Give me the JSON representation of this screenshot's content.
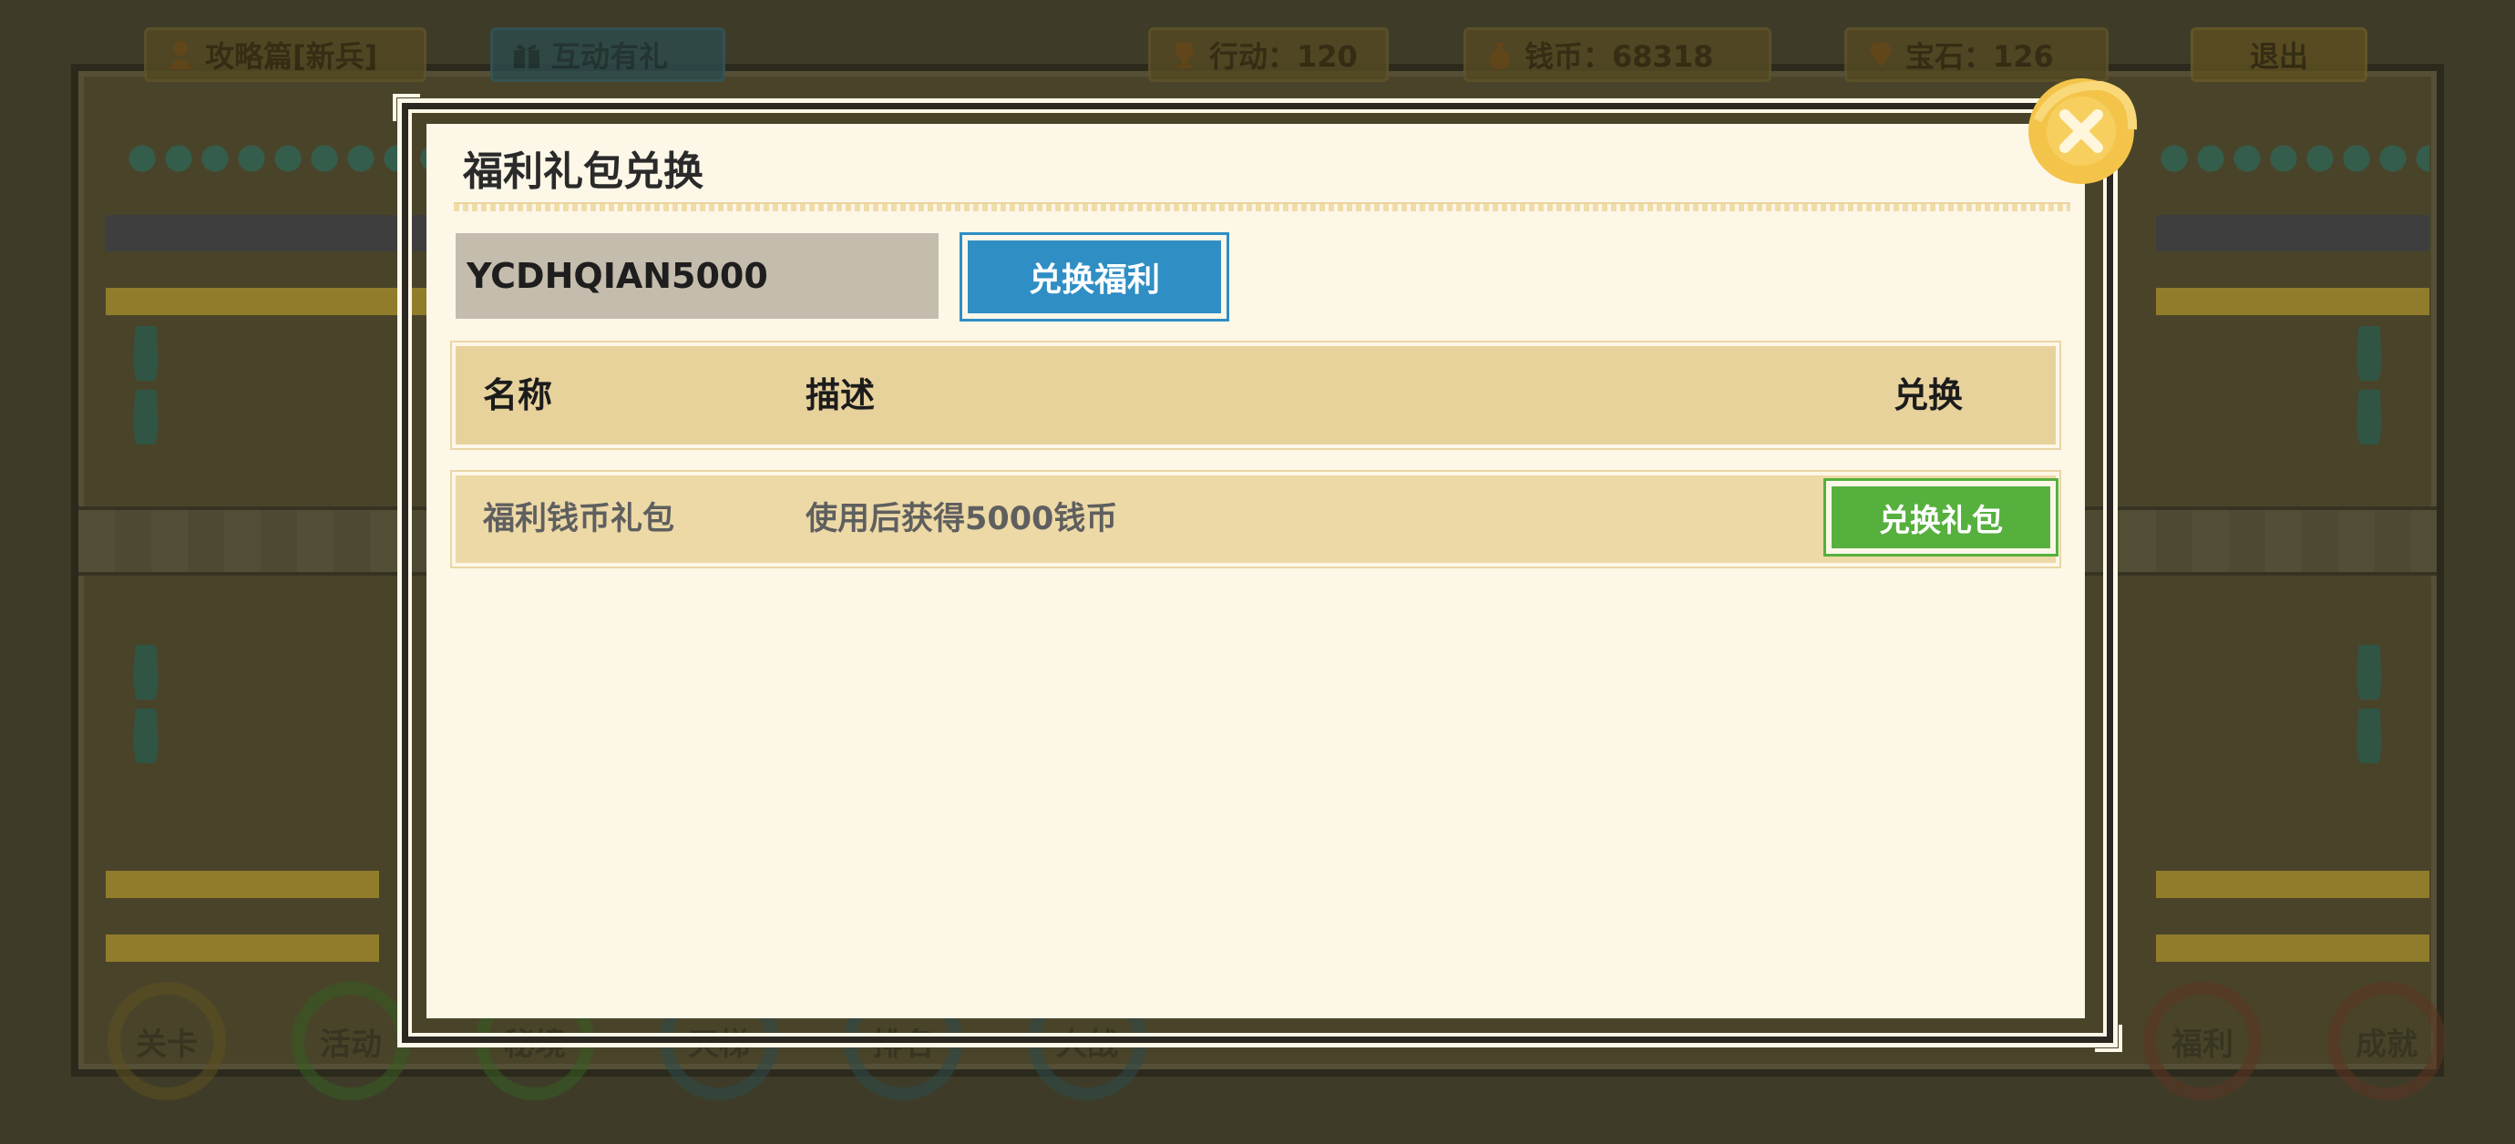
{
  "hud": {
    "guide_label": "攻略篇[新兵]",
    "gift_label": "互动有礼",
    "actions_label": "行动：120",
    "coins_label": "钱币：68318",
    "gems_label": "宝石：126",
    "exit_label": "退出"
  },
  "bottom_nav": [
    {
      "label": "关卡",
      "color": "#7a6428"
    },
    {
      "label": "活动",
      "color": "#3f7a2a"
    },
    {
      "label": "秘境",
      "color": "#3f7a2a"
    },
    {
      "label": "天梯",
      "color": "#2f5d6a"
    },
    {
      "label": "排名",
      "color": "#2f5d6a"
    },
    {
      "label": "大战",
      "color": "#2f5d6a"
    },
    {
      "label": "福利",
      "color": "#7a3a2a"
    },
    {
      "label": "成就",
      "color": "#7a3a2a"
    }
  ],
  "dialog": {
    "title": "福利礼包兑换",
    "code_value": "YCDHQIAN5000",
    "redeem_label": "兑换福利",
    "table": {
      "headers": {
        "name": "名称",
        "description": "描述",
        "action": "兑换"
      },
      "rows": [
        {
          "name": "福利钱币礼包",
          "description": "使用后获得5000钱币",
          "action_label": "兑换礼包"
        }
      ]
    }
  },
  "colors": {
    "redeem_blue": "#2f8ec4",
    "claim_green": "#56b03e",
    "close_gold": "#f4c44a",
    "panel_bg": "#fdf7e8"
  },
  "icons": {
    "close": "close-icon",
    "guide": "person-icon",
    "gift": "gift-icon",
    "actions": "trophy-icon",
    "coins": "money-bag-icon",
    "gems": "gem-icon"
  }
}
